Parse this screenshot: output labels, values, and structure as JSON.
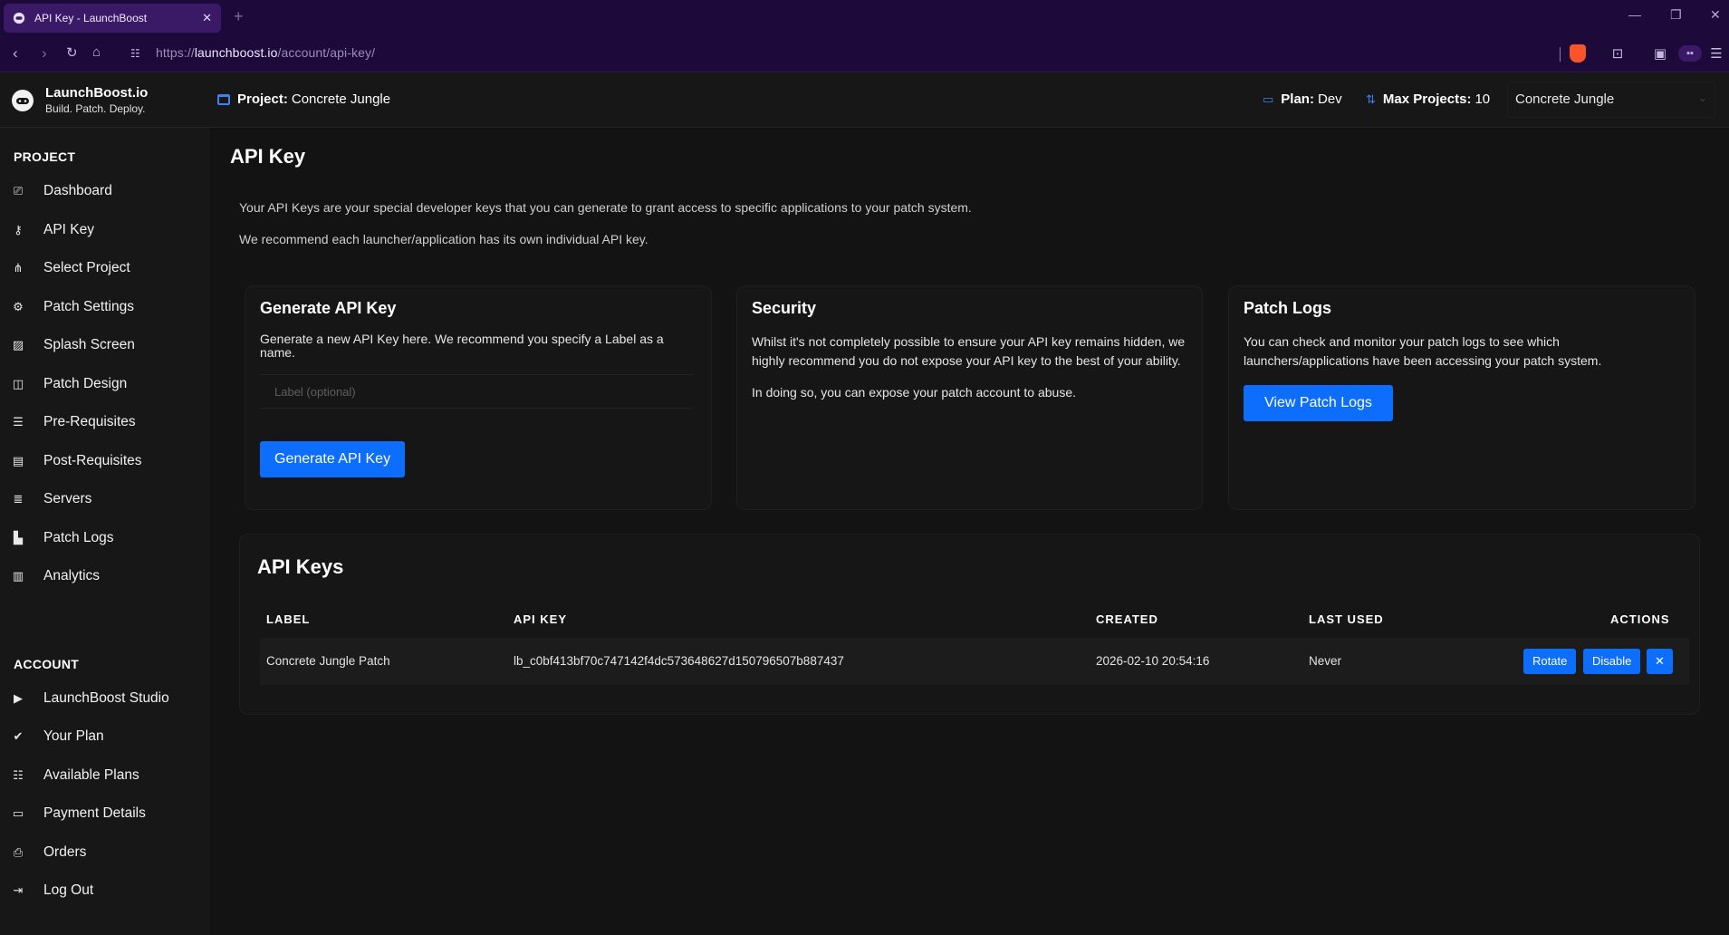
{
  "browser": {
    "tab_title": "API Key - LaunchBoost",
    "tab_close": "✕",
    "new_tab": "+",
    "url_prefix": "https://",
    "url_host": "launchboost.io",
    "url_path": "/account/api-key/"
  },
  "header": {
    "brand": "LaunchBoost.io",
    "tagline": "Build. Patch. Deploy.",
    "project_label": "Project:",
    "project_name": "Concrete Jungle",
    "plan_label": "Plan:",
    "plan_value": "Dev",
    "max_projects_label": "Max Projects:",
    "max_projects_value": "10",
    "project_select": "Concrete Jungle"
  },
  "sidebar": {
    "project_heading": "PROJECT",
    "project_items": [
      {
        "label": "Dashboard",
        "icon": "dashboard-icon"
      },
      {
        "label": "API Key",
        "icon": "key-icon"
      },
      {
        "label": "Select Project",
        "icon": "project-tree-icon"
      },
      {
        "label": "Patch Settings",
        "icon": "gear-icon"
      },
      {
        "label": "Splash Screen",
        "icon": "image-icon"
      },
      {
        "label": "Patch Design",
        "icon": "images-icon"
      },
      {
        "label": "Pre-Requisites",
        "icon": "list-icon"
      },
      {
        "label": "Post-Requisites",
        "icon": "list-alt-icon"
      },
      {
        "label": "Servers",
        "icon": "server-icon"
      },
      {
        "label": "Patch Logs",
        "icon": "file-icon"
      },
      {
        "label": "Analytics",
        "icon": "chart-icon"
      }
    ],
    "account_heading": "ACCOUNT",
    "account_items": [
      {
        "label": "LaunchBoost Studio",
        "icon": "play-icon"
      },
      {
        "label": "Your Plan",
        "icon": "check-icon"
      },
      {
        "label": "Available Plans",
        "icon": "grid-list-icon"
      },
      {
        "label": "Payment Details",
        "icon": "credit-card-icon"
      },
      {
        "label": "Orders",
        "icon": "order-icon"
      },
      {
        "label": "Log Out",
        "icon": "logout-icon"
      }
    ]
  },
  "main": {
    "title": "API Key",
    "intro_1": "Your API Keys are your special developer keys that you can generate to grant access to specific applications to your patch system.",
    "intro_2": "We recommend each launcher/application has its own individual API key.",
    "generate_card": {
      "title": "Generate API Key",
      "text": "Generate a new API Key here. We recommend you specify a Label as a name.",
      "input_placeholder": "Label (optional)",
      "button": "Generate API Key"
    },
    "security_card": {
      "title": "Security",
      "text_1": "Whilst it's not completely possible to ensure your API key remains hidden, we highly recommend you do not expose your API key to the best of your ability.",
      "text_2": "In doing so, you can expose your patch account to abuse."
    },
    "logs_card": {
      "title": "Patch Logs",
      "text": "You can check and monitor your patch logs to see which launchers/applications have been accessing your patch system.",
      "button": "View Patch Logs"
    },
    "keys": {
      "title": "API Keys",
      "columns": [
        "LABEL",
        "API KEY",
        "CREATED",
        "LAST USED",
        "ACTIONS"
      ],
      "rows": [
        {
          "label": "Concrete Jungle Patch",
          "api_key": "lb_c0bf413bf70c747142f4dc573648627d150796507b887437",
          "created": "2026-02-10 20:54:16",
          "last_used": "Never",
          "rotate": "Rotate",
          "disable": "Disable",
          "delete": "✕"
        }
      ]
    }
  },
  "colors": {
    "accent": "#0d6efd",
    "browser_chrome": "#1e0a3a",
    "background": "#131313",
    "panel": "#171717"
  }
}
